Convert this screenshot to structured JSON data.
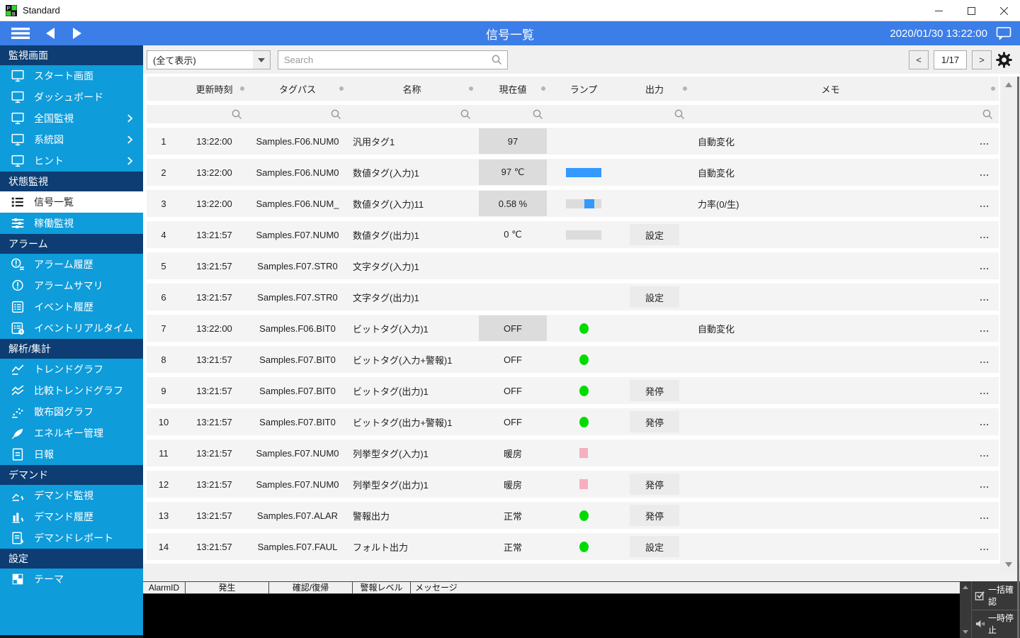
{
  "window": {
    "title": "Standard"
  },
  "topbar": {
    "title": "信号一覧",
    "datetime": "2020/01/30 13:22:00"
  },
  "toolbar": {
    "filter_selected": "(全て表示)",
    "search_placeholder": "Search",
    "prev_label": "<",
    "page_indicator": "1/17",
    "next_label": ">"
  },
  "colors": {
    "topbar_blue": "#3C7EE8",
    "sidebar_cyan": "#0E9CDB",
    "section_navy": "#0D3D72",
    "lamp_blue": "#3399FF",
    "lamp_green": "#00DC00",
    "lamp_pink": "#F5AFC0",
    "value_highlight": "#DCDCDC"
  },
  "sidebar": {
    "sections": [
      {
        "label": "監視画面",
        "items": [
          {
            "label": "スタート画面"
          },
          {
            "label": "ダッシュボード"
          },
          {
            "label": "全国監視",
            "expandable": true
          },
          {
            "label": "系統図",
            "expandable": true
          },
          {
            "label": "ヒント",
            "expandable": true
          }
        ]
      },
      {
        "label": "状態監視",
        "items": [
          {
            "label": "信号一覧",
            "selected": true
          },
          {
            "label": "稼働監視"
          }
        ]
      },
      {
        "label": "アラーム",
        "items": [
          {
            "label": "アラーム履歴"
          },
          {
            "label": "アラームサマリ"
          },
          {
            "label": "イベント履歴"
          },
          {
            "label": "イベントリアルタイム"
          }
        ]
      },
      {
        "label": "解析/集計",
        "items": [
          {
            "label": "トレンドグラフ"
          },
          {
            "label": "比較トレンドグラフ"
          },
          {
            "label": "散布図グラフ"
          },
          {
            "label": "エネルギー管理"
          },
          {
            "label": "日報"
          }
        ]
      },
      {
        "label": "デマンド",
        "items": [
          {
            "label": "デマンド監視"
          },
          {
            "label": "デマンド履歴"
          },
          {
            "label": "デマンドレポート"
          }
        ]
      },
      {
        "label": "設定",
        "items": [
          {
            "label": "テーマ"
          }
        ]
      }
    ]
  },
  "table": {
    "columns": {
      "time": "更新時刻",
      "tag": "タグパス",
      "name": "名称",
      "value": "現在値",
      "lamp": "ランプ",
      "output": "出力",
      "memo": "メモ"
    },
    "rows": [
      {
        "num": "1",
        "time": "13:22:00",
        "tag": "Samples.F06.NUM0",
        "name": "汎用タグ1",
        "value": "97",
        "memo": "自動変化",
        "more": "..."
      },
      {
        "num": "2",
        "time": "13:22:00",
        "tag": "Samples.F06.NUM0",
        "name": "数値タグ(入力)1",
        "value": "97 ℃",
        "memo": "自動変化",
        "more": "..."
      },
      {
        "num": "3",
        "time": "13:22:00",
        "tag": "Samples.F06.NUM_",
        "name": "数値タグ(入力)11",
        "value": "0.58 %",
        "memo": "力率(0/生)",
        "more": "..."
      },
      {
        "num": "4",
        "time": "13:21:57",
        "tag": "Samples.F07.NUM0",
        "name": "数値タグ(出力)1",
        "value": "0 ℃",
        "output": "設定",
        "memo": "",
        "more": "..."
      },
      {
        "num": "5",
        "time": "13:21:57",
        "tag": "Samples.F07.STR0",
        "name": "文字タグ(入力)1",
        "value": "",
        "memo": "",
        "more": "..."
      },
      {
        "num": "6",
        "time": "13:21:57",
        "tag": "Samples.F07.STR0",
        "name": "文字タグ(出力)1",
        "value": "",
        "output": "設定",
        "memo": "",
        "more": "..."
      },
      {
        "num": "7",
        "time": "13:22:00",
        "tag": "Samples.F06.BIT0",
        "name": "ビットタグ(入力)1",
        "value": "OFF",
        "memo": "自動変化",
        "more": "..."
      },
      {
        "num": "8",
        "time": "13:21:57",
        "tag": "Samples.F07.BIT0",
        "name": "ビットタグ(入力+警報)1",
        "value": "OFF",
        "memo": "",
        "more": "..."
      },
      {
        "num": "9",
        "time": "13:21:57",
        "tag": "Samples.F07.BIT0",
        "name": "ビットタグ(出力)1",
        "value": "OFF",
        "output": "発停",
        "memo": "",
        "more": "..."
      },
      {
        "num": "10",
        "time": "13:21:57",
        "tag": "Samples.F07.BIT0",
        "name": "ビットタグ(出力+警報)1",
        "value": "OFF",
        "output": "発停",
        "memo": "",
        "more": "..."
      },
      {
        "num": "11",
        "time": "13:21:57",
        "tag": "Samples.F07.NUM0",
        "name": "列挙型タグ(入力)1",
        "value": "暖房",
        "memo": "",
        "more": "..."
      },
      {
        "num": "12",
        "time": "13:21:57",
        "tag": "Samples.F07.NUM0",
        "name": "列挙型タグ(出力)1",
        "value": "暖房",
        "output": "発停",
        "memo": "",
        "more": "..."
      },
      {
        "num": "13",
        "time": "13:21:57",
        "tag": "Samples.F07.ALAR",
        "name": "警報出力",
        "value": "正常",
        "output": "発停",
        "memo": "",
        "more": "..."
      },
      {
        "num": "14",
        "time": "13:21:57",
        "tag": "Samples.F07.FAUL",
        "name": "フォルト出力",
        "value": "正常",
        "output": "設定",
        "memo": "",
        "more": "..."
      }
    ]
  },
  "alarm_panel": {
    "columns": [
      "AlarmID",
      "発生",
      "確認/復帰",
      "警報レベル",
      "メッセージ"
    ],
    "buttons": [
      {
        "label": "一括確認"
      },
      {
        "label": "一時停止"
      }
    ]
  }
}
